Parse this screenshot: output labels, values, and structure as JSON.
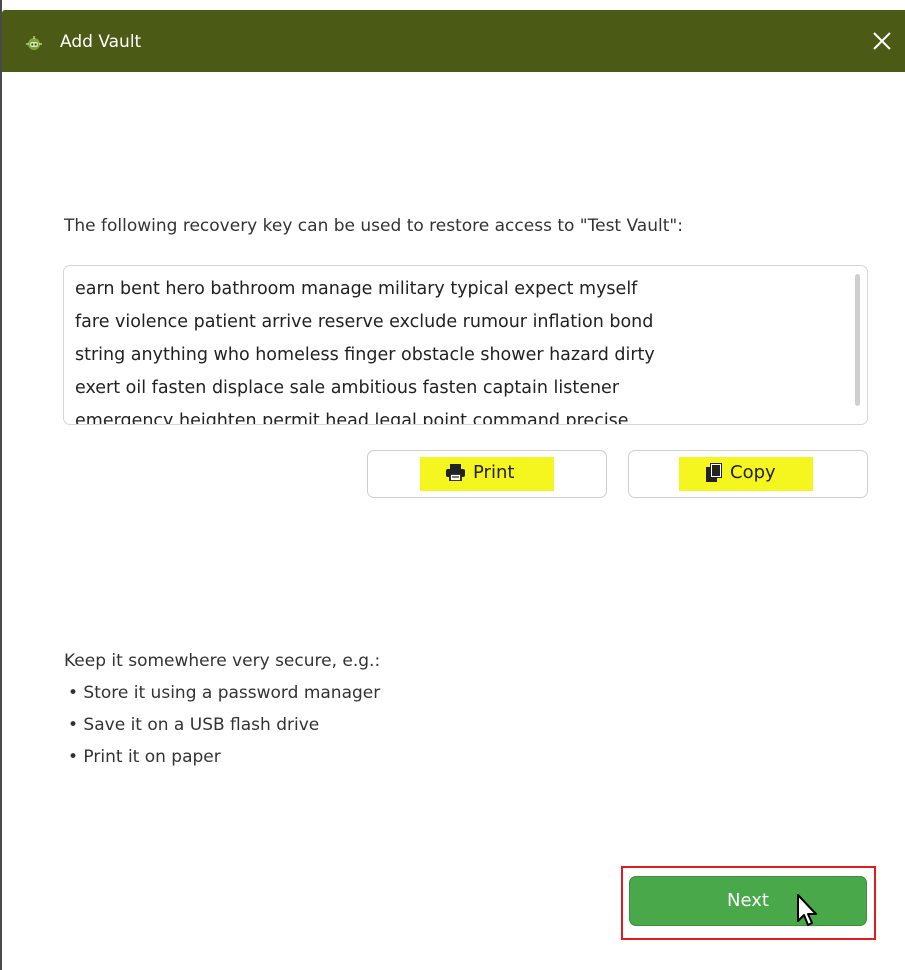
{
  "window": {
    "title": "Add Vault",
    "close_glyph": "✕",
    "title_icon": "robot-icon"
  },
  "main": {
    "prompt": "The following recovery key can be used to restore access to \"Test Vault\":",
    "recovery_key": "earn bent hero bathroom manage military typical expect myself\nfare violence patient arrive reserve exclude rumour inflation bond\nstring anything who homeless finger obstacle shower hazard dirty\nexert oil fasten displace sale ambitious fasten captain listener\nemergency heighten permit head legal point command precise",
    "print_label": "Print",
    "print_icon": "printer-icon",
    "copy_label": "Copy",
    "copy_icon": "clipboard-icon",
    "highlight_color": "#f5f520",
    "info_heading": "Keep it somewhere very secure, e.g.:",
    "tips": [
      "• Store it using a password manager",
      "• Save it on a USB flash drive",
      "• Print it on paper"
    ]
  },
  "footer": {
    "next_label": "Next",
    "next_color": "#48a84a",
    "highlight_frame_color": "#e01c1c"
  },
  "colors": {
    "titlebar": "#4b5b16"
  }
}
